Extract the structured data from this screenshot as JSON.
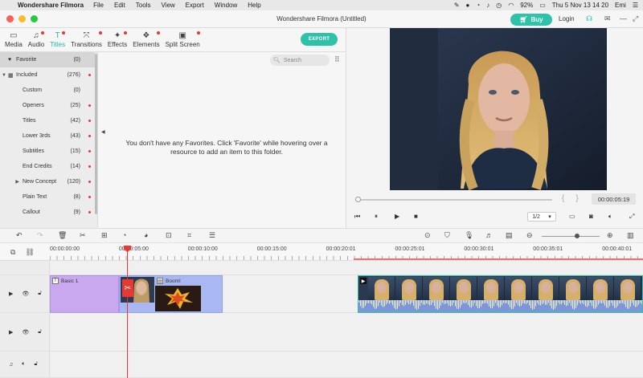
{
  "menubar": {
    "app_name": "Wondershare Filmora",
    "menus": [
      "File",
      "Edit",
      "Tools",
      "View",
      "Export",
      "Window",
      "Help"
    ],
    "battery": "92%",
    "clock": "Thu 5 Nov  13 14 20",
    "user": "Emi"
  },
  "window": {
    "title": "Wondershare Filmora (Untitled)",
    "buy_label": "Buy",
    "login_label": "Login"
  },
  "media_tabs": [
    {
      "label": "Media",
      "icon": "folder-icon",
      "glyph": "▭",
      "dot": false,
      "active": false
    },
    {
      "label": "Audio",
      "icon": "music-note-icon",
      "glyph": "♫",
      "dot": true,
      "active": false
    },
    {
      "label": "Titles",
      "icon": "titles-icon",
      "glyph": "T",
      "dot": true,
      "active": true
    },
    {
      "label": "Transitions",
      "icon": "transitions-icon",
      "glyph": "⤧",
      "dot": true,
      "active": false
    },
    {
      "label": "Effects",
      "icon": "effects-icon",
      "glyph": "✦",
      "dot": true,
      "active": false
    },
    {
      "label": "Elements",
      "icon": "elements-icon",
      "glyph": "❖",
      "dot": true,
      "active": false
    },
    {
      "label": "Split Screen",
      "icon": "split-screen-icon",
      "glyph": "▣",
      "dot": true,
      "active": false
    }
  ],
  "export_label": "EXPORT",
  "library": {
    "items": [
      {
        "label": "Favorite",
        "count": "(0)",
        "indent": false,
        "selected": true,
        "icon": "heart-icon",
        "dot": false,
        "caret": ""
      },
      {
        "label": "Included",
        "count": "(276)",
        "indent": false,
        "selected": false,
        "icon": "grid-icon",
        "dot": true,
        "caret": "▼"
      },
      {
        "label": "Custom",
        "count": "(0)",
        "indent": true,
        "selected": false,
        "dot": false,
        "caret": ""
      },
      {
        "label": "Openers",
        "count": "(25)",
        "indent": true,
        "selected": false,
        "dot": true,
        "caret": ""
      },
      {
        "label": "Titles",
        "count": "(42)",
        "indent": true,
        "selected": false,
        "dot": true,
        "caret": ""
      },
      {
        "label": "Lower 3rds",
        "count": "(43)",
        "indent": true,
        "selected": false,
        "dot": true,
        "caret": ""
      },
      {
        "label": "Subtitles",
        "count": "(15)",
        "indent": true,
        "selected": false,
        "dot": true,
        "caret": ""
      },
      {
        "label": "End Credits",
        "count": "(14)",
        "indent": true,
        "selected": false,
        "dot": true,
        "caret": ""
      },
      {
        "label": "New Concept",
        "count": "(120)",
        "indent": true,
        "selected": false,
        "dot": true,
        "caret": "▶"
      },
      {
        "label": "Plain Text",
        "count": "(8)",
        "indent": true,
        "selected": false,
        "dot": true,
        "caret": ""
      },
      {
        "label": "Callout",
        "count": "(9)",
        "indent": true,
        "selected": false,
        "dot": true,
        "caret": ""
      }
    ],
    "search_placeholder": "Search",
    "empty_message": "You don't have any Favorites. Click 'Favorite' while hovering over a resource to add an item to this folder."
  },
  "preview": {
    "timecode": "00:00:05:19",
    "ratio": "1/2",
    "progress": 0.0
  },
  "timeline": {
    "ruler_ticks": [
      "00:00:00:00",
      "00:00:05:00",
      "00:00:10:00",
      "00:00:15:00",
      "00:00:20:01",
      "00:00:25:01",
      "00:00:30:01",
      "00:00:35:01",
      "00:00:40:01"
    ],
    "clips": {
      "title_clip": "Basic 1",
      "boom_clip": "Boom!"
    },
    "zoom_level": 0.6
  },
  "colors": {
    "accent": "#2ec3a8",
    "playhead": "#e53935",
    "title_clip": "#c9a8ef",
    "boom_clip": "#a9b8f2"
  }
}
